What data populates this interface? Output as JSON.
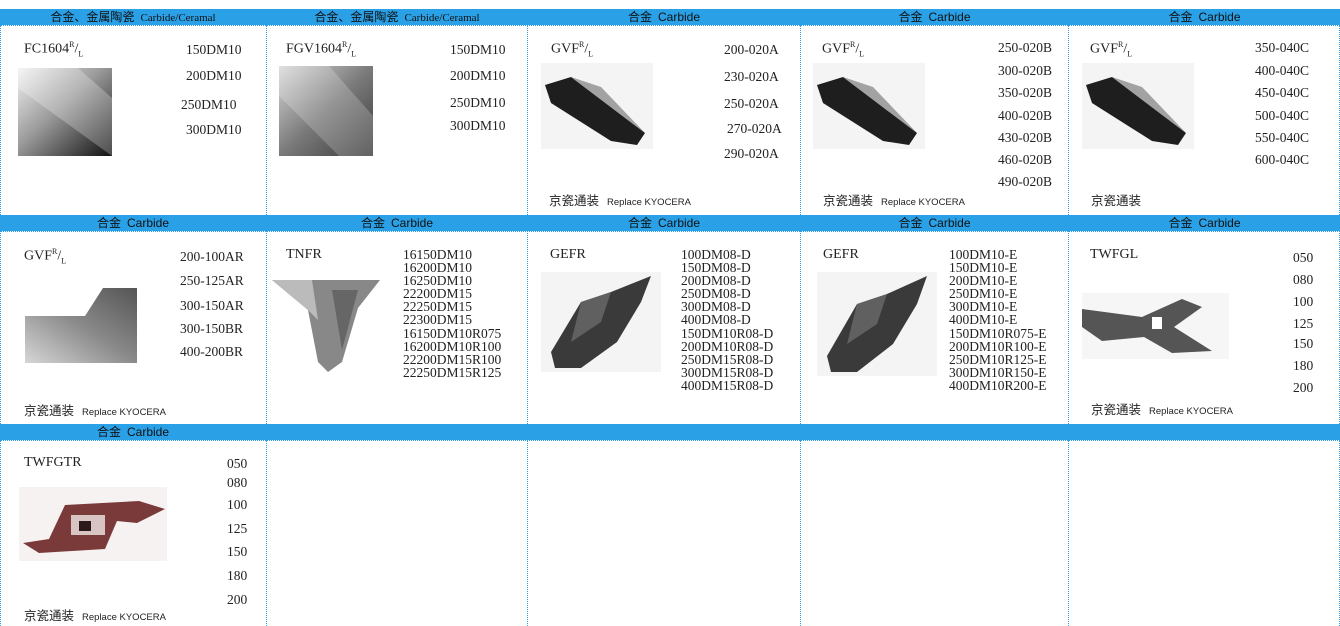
{
  "bands": [
    {
      "cells": [
        {
          "zh": "合金、金属陶瓷",
          "en": "Carbide/Ceramal"
        },
        {
          "zh": "合金、金属陶瓷",
          "en": "Carbide/Ceramal"
        },
        {
          "zh": "合金",
          "en": "Carbide"
        },
        {
          "zh": "合金",
          "en": "Carbide"
        },
        {
          "zh": "合金",
          "en": "Carbide"
        }
      ]
    },
    {
      "cells": [
        {
          "zh": "合金",
          "en": "Carbide"
        },
        {
          "zh": "合金",
          "en": "Carbide"
        },
        {
          "zh": "合金",
          "en": "Carbide"
        },
        {
          "zh": "合金",
          "en": "Carbide"
        },
        {
          "zh": "合金",
          "en": "Carbide"
        }
      ]
    },
    {
      "cells": [
        {
          "zh": "合金",
          "en": "Carbide"
        }
      ]
    }
  ],
  "cells": {
    "r1c1": {
      "title": "FC1604",
      "sup": "R",
      "slash": "/",
      "sub": "L",
      "codes": [
        "150DM10",
        "200DM10",
        "250DM10",
        "300DM10"
      ]
    },
    "r1c2": {
      "title": "FGV1604",
      "sup": "R",
      "slash": "/",
      "sub": "L",
      "codes": [
        "150DM10",
        "200DM10",
        "250DM10",
        "300DM10"
      ]
    },
    "r1c3": {
      "title": "GVF",
      "sup": "R",
      "slash": "/",
      "sub": "L",
      "codes": [
        "200-020A",
        "230-020A",
        "250-020A",
        "270-020A",
        "290-020A"
      ],
      "foot_zh": "京瓷通装",
      "foot_en": "Replace KYOCERA"
    },
    "r1c4": {
      "title": "GVF",
      "sup": "R",
      "slash": "/",
      "sub": "L",
      "codes": [
        "250-020B",
        "300-020B",
        "350-020B",
        "400-020B",
        "430-020B",
        "460-020B",
        "490-020B"
      ],
      "foot_zh": "京瓷通装",
      "foot_en": "Replace KYOCERA"
    },
    "r1c5": {
      "title": "GVF",
      "sup": "R",
      "slash": "/",
      "sub": "L",
      "codes": [
        "350-040C",
        "400-040C",
        "450-040C",
        "500-040C",
        "550-040C",
        "600-040C"
      ],
      "foot_zh": "京瓷通装"
    },
    "r2c1": {
      "title": "GVF",
      "sup": "R",
      "slash": "/",
      "sub": "L",
      "codes": [
        "200-100AR",
        "250-125AR",
        "300-150AR",
        "300-150BR",
        "400-200BR"
      ],
      "foot_zh": "京瓷通装",
      "foot_en": "Replace KYOCERA"
    },
    "r2c2": {
      "title": "TNFR",
      "codes": [
        "16150DM10",
        "16200DM10",
        "16250DM10",
        "22200DM15",
        "22250DM15",
        "22300DM15",
        "16150DM10R075",
        "16200DM10R100",
        "22200DM15R100",
        "22250DM15R125"
      ]
    },
    "r2c3": {
      "title": "GEFR",
      "codes": [
        "100DM08-D",
        "150DM08-D",
        "200DM08-D",
        "250DM08-D",
        "300DM08-D",
        "400DM08-D",
        "150DM10R08-D",
        "200DM10R08-D",
        "250DM15R08-D",
        "300DM15R08-D",
        "400DM15R08-D"
      ]
    },
    "r2c4": {
      "title": "GEFR",
      "codes": [
        "100DM10-E",
        "150DM10-E",
        "200DM10-E",
        "250DM10-E",
        "300DM10-E",
        "400DM10-E",
        "150DM10R075-E",
        "200DM10R100-E",
        "250DM10R125-E",
        "300DM10R150-E",
        "400DM10R200-E"
      ]
    },
    "r2c5": {
      "title": "TWFGL",
      "codes": [
        "050",
        "080",
        "100",
        "125",
        "150",
        "180",
        "200"
      ],
      "foot_zh": "京瓷通装",
      "foot_en": "Replace KYOCERA"
    },
    "r3c1": {
      "title": "TWFGTR",
      "codes": [
        "050",
        "080",
        "100",
        "125",
        "150",
        "180",
        "200"
      ],
      "foot_zh": "京瓷通装",
      "foot_en": "Replace KYOCERA"
    }
  },
  "icons": {
    "r1c1": "insert-photo-icon",
    "r1c2": "insert-photo-icon",
    "r1c3": "insert-photo-icon",
    "r1c4": "insert-photo-icon",
    "r1c5": "insert-photo-icon",
    "r2c1": "insert-photo-icon",
    "r2c2": "insert-photo-icon",
    "r2c3": "insert-photo-icon",
    "r2c4": "insert-photo-icon",
    "r2c5": "insert-photo-icon",
    "r3c1": "insert-photo-icon"
  },
  "colors": {
    "band": "#2aa0e6",
    "grid": "#2aa0e6"
  }
}
